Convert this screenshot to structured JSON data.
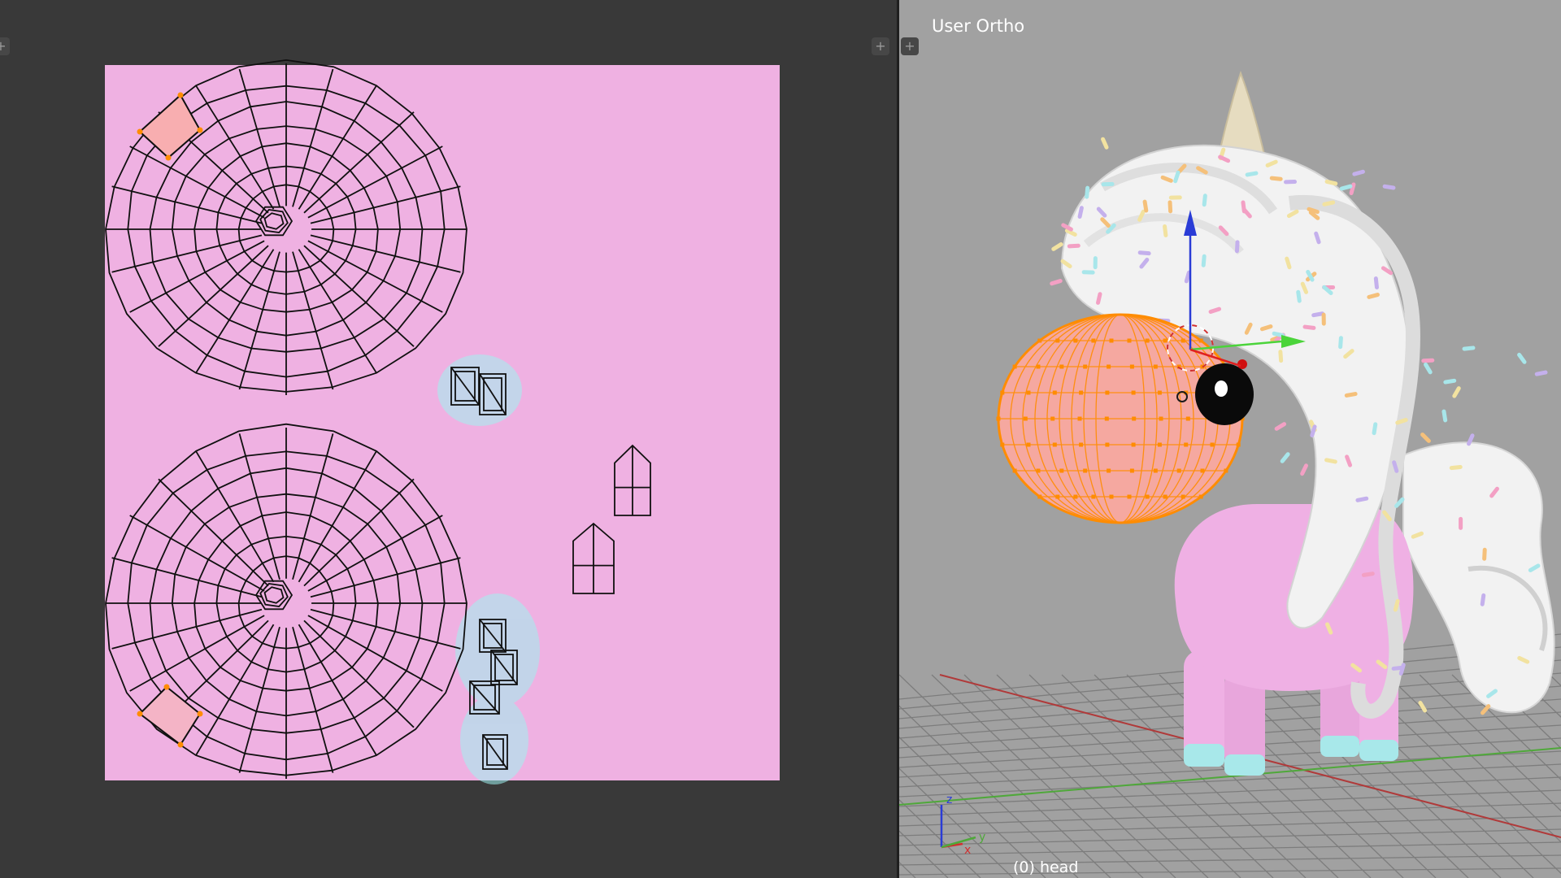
{
  "uv_editor": {
    "background_color": "#393939",
    "texture_color": "#efb1e2",
    "wire_color": "#101010",
    "selected_face_color": "#f8aeb0",
    "selected_vertex_color": "#ff8c00",
    "highlight_island_color": "#9ef2f0",
    "corner_widgets": [
      "+",
      "+"
    ]
  },
  "viewport": {
    "view_label": "User Ortho",
    "object_label": "(0) head",
    "background_color": "#a1a1a1",
    "grid_color": "#7d7d7d",
    "x_axis_color": "#b03a3a",
    "y_axis_color": "#4fa83a",
    "corner_widget": "+",
    "gizmo": {
      "z_label": "z",
      "y_label": "y",
      "x_label": "x"
    },
    "model": {
      "body_color": "#efb0e4",
      "hoof_color": "#a8e8ea",
      "mane_color": "#f2f2f2",
      "horn_color": "#e6dcc0",
      "head_color": "#f5a8a0",
      "head_wire_color": "#ff8c00",
      "eye_color": "#0a0a0a",
      "sprinkle_colors": [
        "#f3a0c4",
        "#a8e6ea",
        "#c4b0ec",
        "#f2e2a0",
        "#f5c07a"
      ]
    }
  }
}
